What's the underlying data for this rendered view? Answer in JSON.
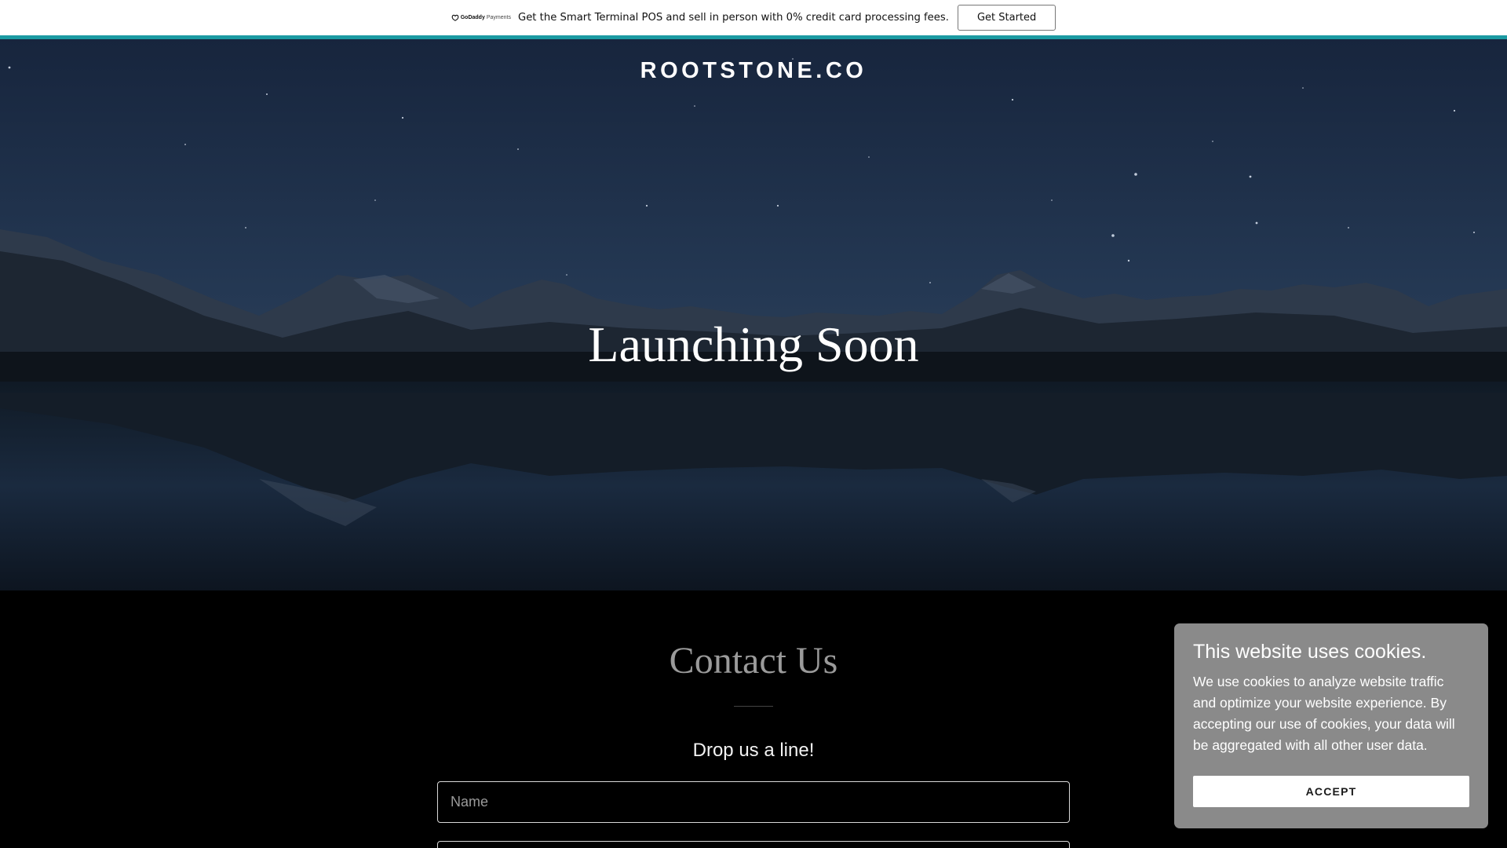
{
  "promo": {
    "logo_brand": "GoDaddy",
    "logo_product": "Payments",
    "text": "Get the Smart Terminal POS and sell in person with 0% credit card processing fees.",
    "button_label": "Get Started",
    "logo_icon": "godaddy-logo-icon"
  },
  "colors": {
    "accent": "#1b9aa2",
    "cookie_panel": "#8a8a8a",
    "contact_bg": "#000000"
  },
  "header": {
    "site_title": "ROOTSTONE.CO"
  },
  "hero": {
    "heading": "Launching Soon"
  },
  "contact": {
    "title": "Contact Us",
    "subtitle": "Drop us a line!",
    "name_placeholder": "Name"
  },
  "cookie": {
    "title": "This website uses cookies.",
    "text": "We use cookies to analyze website traffic and optimize your website experience. By accepting our use of cookies, your data will be aggregated with all other user data.",
    "accept_label": "ACCEPT"
  }
}
